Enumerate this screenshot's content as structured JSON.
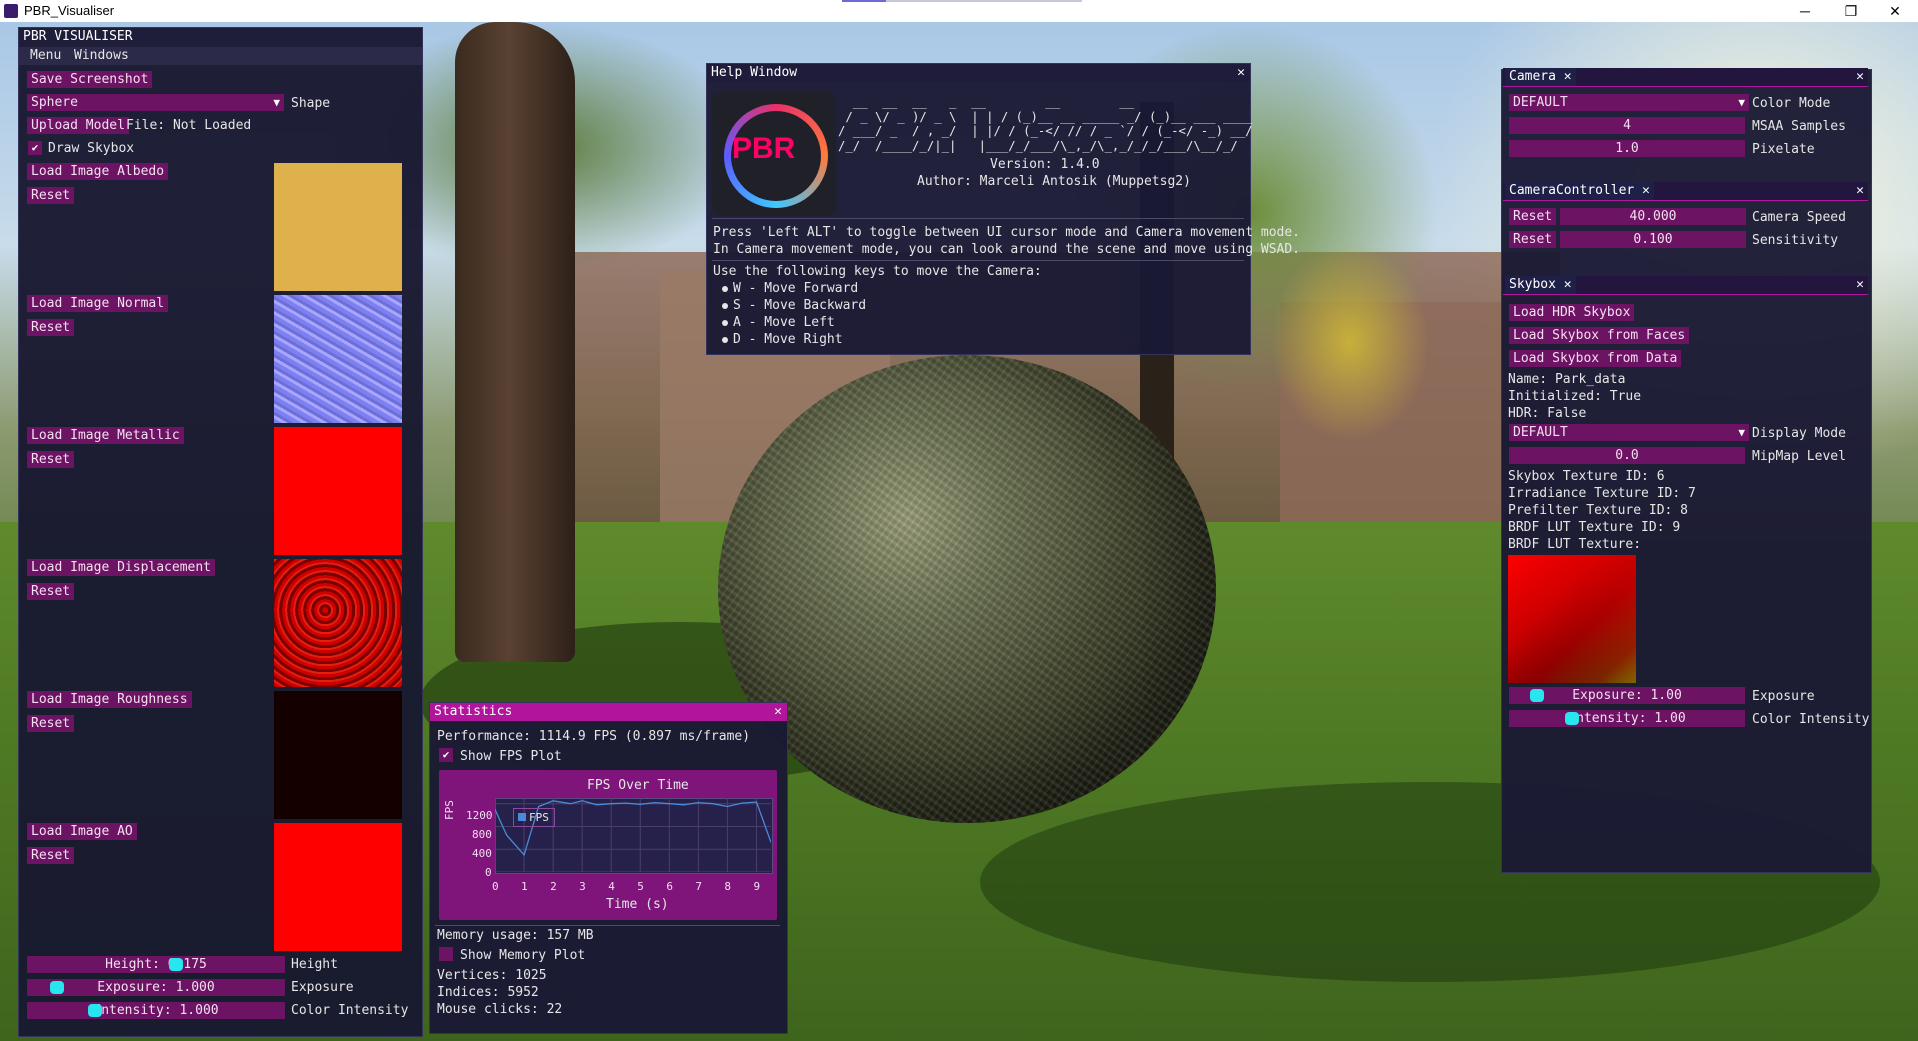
{
  "window": {
    "title": "PBR_Visualiser",
    "minimize": "─",
    "restore": "❐",
    "close": "✕"
  },
  "left_panel": {
    "title": "PBR VISUALISER",
    "menu": [
      "Menu",
      "Windows"
    ],
    "save_screenshot": "Save Screenshot",
    "shape_value": "Sphere",
    "shape_label": "Shape",
    "upload_model": "Upload Model",
    "file_status": "File: Not Loaded",
    "draw_skybox": "Draw Skybox",
    "draw_skybox_checked": true,
    "textures": [
      {
        "button": "Load Image Albedo",
        "reset": "Reset",
        "color": "#dfb14d"
      },
      {
        "button": "Load Image Normal",
        "reset": "Reset",
        "color": "#8b8cf0"
      },
      {
        "button": "Load Image Metallic",
        "reset": "Reset",
        "color": "#ff0000"
      },
      {
        "button": "Load Image Displacement",
        "reset": "Reset",
        "color": "#c00000"
      },
      {
        "button": "Load Image Roughness",
        "reset": "Reset",
        "color": "#150000"
      },
      {
        "button": "Load Image AO",
        "reset": "Reset",
        "color": "#ff0000"
      }
    ],
    "height_slider": "Height: 0.175",
    "height_label": "Height",
    "exposure_slider": "Exposure: 1.000",
    "exposure_label": "Exposure",
    "intensity_slider": "Intensity: 1.000",
    "intensity_label": "Color Intensity"
  },
  "help_window": {
    "title": "Help Window",
    "logo_text": "PBR",
    "ascii_art": "  __  __  __   _  __        __        __   \n / _ \\/ _ )/ _ \\  | | / (_)__ __ _____ _/ (_)__ ___ ____\n/ ___/ _  / , _/  | |/ / (_-</ // / _ `/ / (_-</ -_) __/\n/_/  /____/_/|_|   |___/_/___/\\_,_/\\_,_/_/_/___/\\__/_/",
    "version": "Version: 1.4.0",
    "author": "Author: Marceli Antosik (Muppetsg2)",
    "line1": "Press 'Left ALT' to toggle between UI cursor mode and Camera movement mode.",
    "line2": "In Camera movement mode, you can look around the scene and move using WSAD.",
    "keys_intro": "Use the following keys to move the Camera:",
    "keys": [
      "W - Move Forward",
      "S - Move Backward",
      "A - Move Left",
      "D - Move Right"
    ]
  },
  "statistics": {
    "title": "Statistics",
    "performance": "Performance: 1114.9 FPS (0.897 ms/frame)",
    "show_fps_plot": "Show FPS Plot",
    "show_fps_checked": true,
    "plot_title": "FPS Over Time",
    "plot_legend": "FPS",
    "plot_ylabel": "FPS",
    "plot_xlabel": "Time (s)",
    "y_ticks": [
      "1200",
      "800",
      "400",
      "0"
    ],
    "x_ticks": [
      "0",
      "1",
      "2",
      "3",
      "4",
      "5",
      "6",
      "7",
      "8",
      "9"
    ],
    "memory": "Memory usage: 157 MB",
    "show_memory_plot": "Show Memory Plot",
    "show_memory_checked": false,
    "vertices": "Vertices: 1025",
    "indices": "Indices: 5952",
    "mouse_clicks": "Mouse clicks: 22"
  },
  "chart_data": {
    "type": "line",
    "title": "FPS Over Time",
    "xlabel": "Time (s)",
    "ylabel": "FPS",
    "ylim": [
      0,
      1300
    ],
    "xlim": [
      0,
      9.5
    ],
    "series": [
      {
        "name": "FPS",
        "x": [
          0,
          0.4,
          1.0,
          1.5,
          2.0,
          2.6,
          3.0,
          3.5,
          4.0,
          4.5,
          5.0,
          5.5,
          6.0,
          6.5,
          7.0,
          7.5,
          8.0,
          8.5,
          9.0,
          9.5
        ],
        "y": [
          1100,
          650,
          300,
          1150,
          1250,
          1200,
          1250,
          1180,
          1200,
          1210,
          1190,
          1220,
          1200,
          1180,
          1220,
          1200,
          1150,
          1210,
          1230,
          520
        ]
      }
    ]
  },
  "camera": {
    "tab": "Camera",
    "color_mode_value": "DEFAULT",
    "color_mode_label": "Color Mode",
    "msaa_value": "4",
    "msaa_label": "MSAA Samples",
    "pixelate_value": "1.0",
    "pixelate_label": "Pixelate"
  },
  "camera_controller": {
    "tab": "CameraController",
    "reset": "Reset",
    "speed_value": "40.000",
    "speed_label": "Camera Speed",
    "sensitivity_value": "0.100",
    "sensitivity_label": "Sensitivity"
  },
  "skybox": {
    "tab": "Skybox",
    "load_hdr": "Load HDR Skybox",
    "load_faces": "Load Skybox from Faces",
    "load_data": "Load Skybox from Data",
    "name": "Name: Park_data",
    "initialized": "Initialized: True",
    "hdr": "HDR: False",
    "display_mode_value": "DEFAULT",
    "display_mode_label": "Display Mode",
    "mipmap_value": "0.0",
    "mipmap_label": "MipMap Level",
    "skybox_tex": "Skybox Texture ID: 6",
    "irradiance_tex": "Irradiance Texture ID: 7",
    "prefilter_tex": "Prefilter Texture ID: 8",
    "brdf_lut_id": "BRDF LUT Texture ID: 9",
    "brdf_lut_label": "BRDF LUT Texture:",
    "exposure_slider": "Exposure: 1.00",
    "exposure_label": "Exposure",
    "intensity_slider": "Intensity: 1.00",
    "intensity_label": "Color Intensity"
  }
}
